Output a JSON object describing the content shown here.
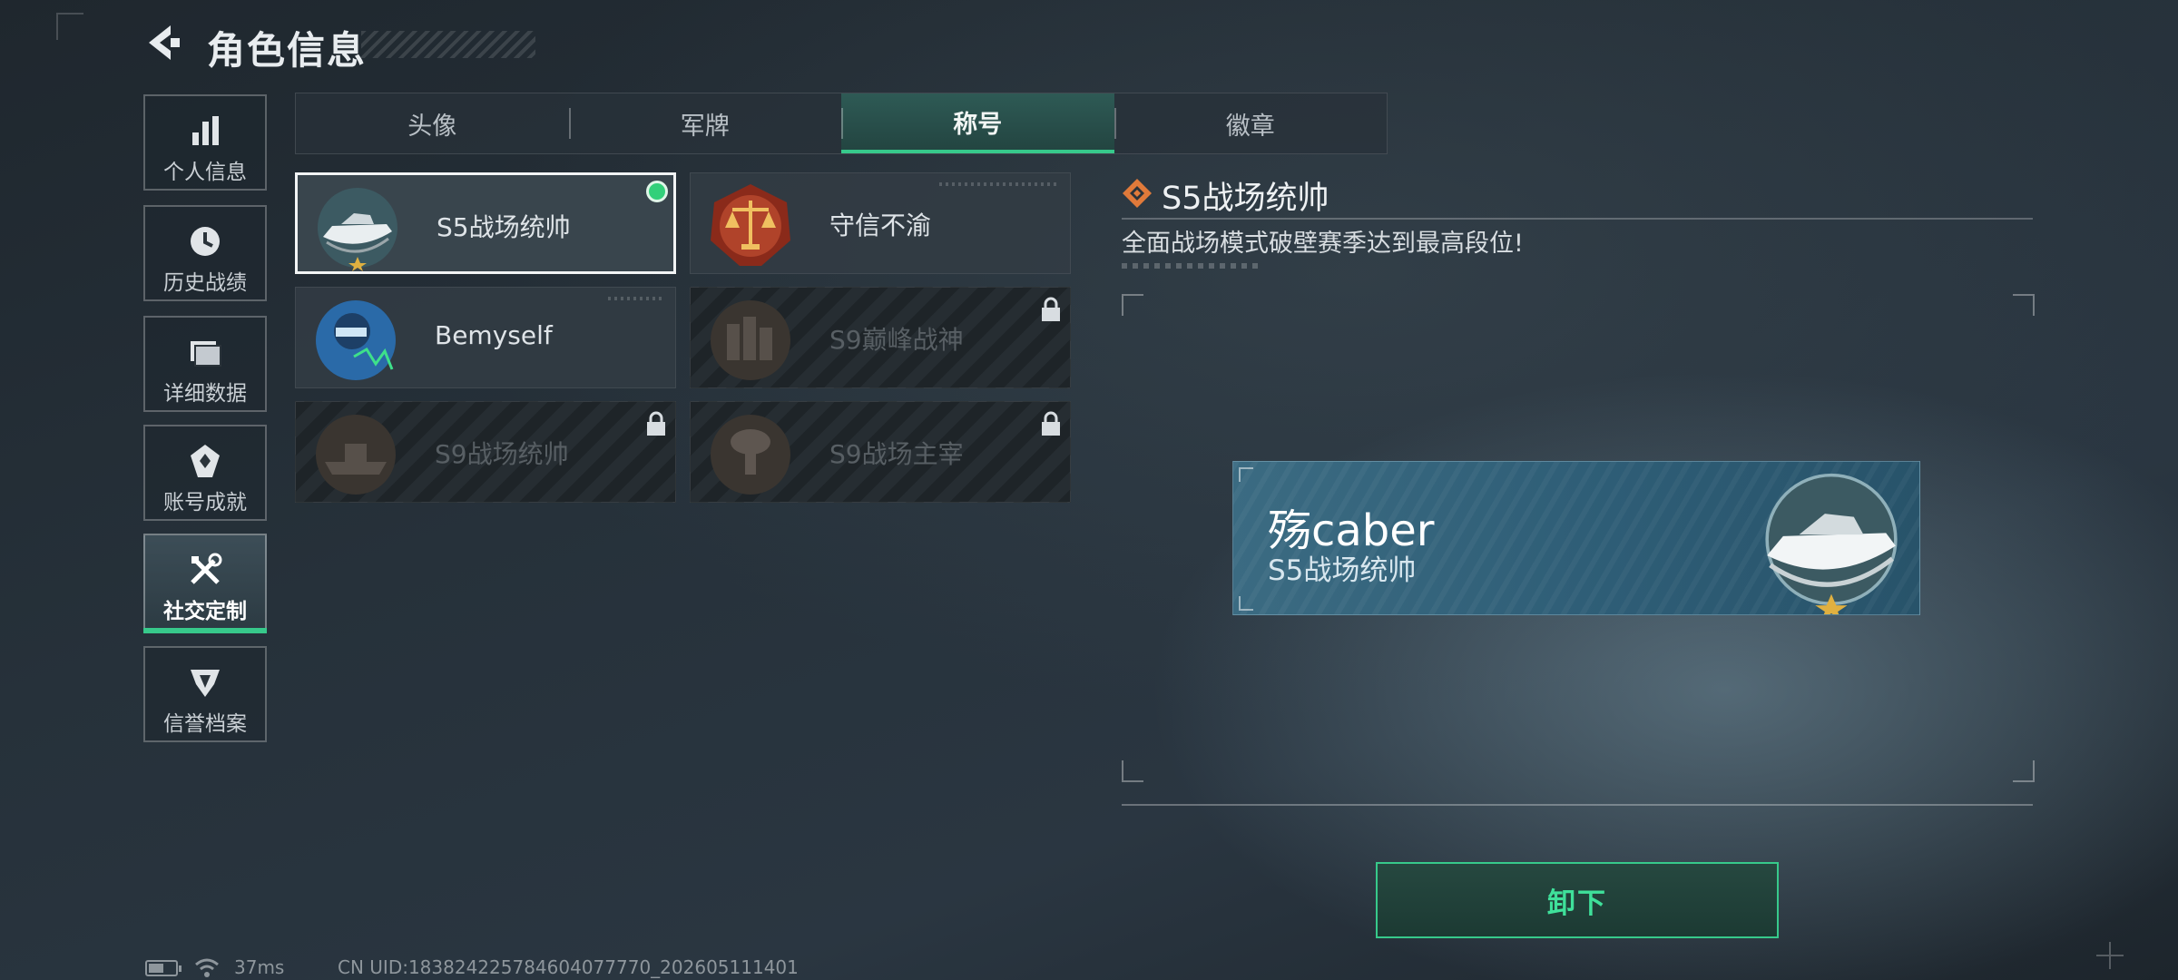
{
  "header": {
    "title": "角色信息"
  },
  "sidebar": {
    "items": [
      {
        "label": "个人信息",
        "icon": "bar-chart-icon"
      },
      {
        "label": "历史战绩",
        "icon": "clock-icon"
      },
      {
        "label": "详细数据",
        "icon": "folder-icon"
      },
      {
        "label": "账号成就",
        "icon": "achievement-icon"
      },
      {
        "label": "社交定制",
        "icon": "tools-icon",
        "active": true
      },
      {
        "label": "信誉档案",
        "icon": "credit-shield-icon"
      }
    ]
  },
  "tabs": [
    {
      "label": "头像"
    },
    {
      "label": "军牌"
    },
    {
      "label": "称号",
      "active": true
    },
    {
      "label": "徽章"
    }
  ],
  "titles": [
    {
      "name": "S5战场统帅",
      "emblem": "speedboat-emblem",
      "selected": true,
      "equipped": true,
      "locked": false
    },
    {
      "name": "守信不渝",
      "emblem": "scales-emblem",
      "selected": false,
      "locked": false
    },
    {
      "name": "Bemyself",
      "emblem": "soldier-emblem",
      "selected": false,
      "locked": false
    },
    {
      "name": "S9巅峰战神",
      "emblem": "fortress-emblem",
      "selected": false,
      "locked": true
    },
    {
      "name": "S9战场统帅",
      "emblem": "ship-emblem",
      "selected": false,
      "locked": true
    },
    {
      "name": "S9战场主宰",
      "emblem": "mushroom-cloud-emblem",
      "selected": false,
      "locked": true
    }
  ],
  "detail": {
    "title": "S5战场统帅",
    "description": "全面战场模式破壁赛季达到最高段位!"
  },
  "nameplate": {
    "player_name": "殇caber",
    "title": "S5战场统帅"
  },
  "action": {
    "unequip_label": "卸下"
  },
  "status_bar": {
    "ping": "37ms",
    "uid": "CN UID:183824225784604077770_202605111401"
  },
  "colors": {
    "accent": "#37c98b",
    "detail_icon": "#e07a3a"
  }
}
